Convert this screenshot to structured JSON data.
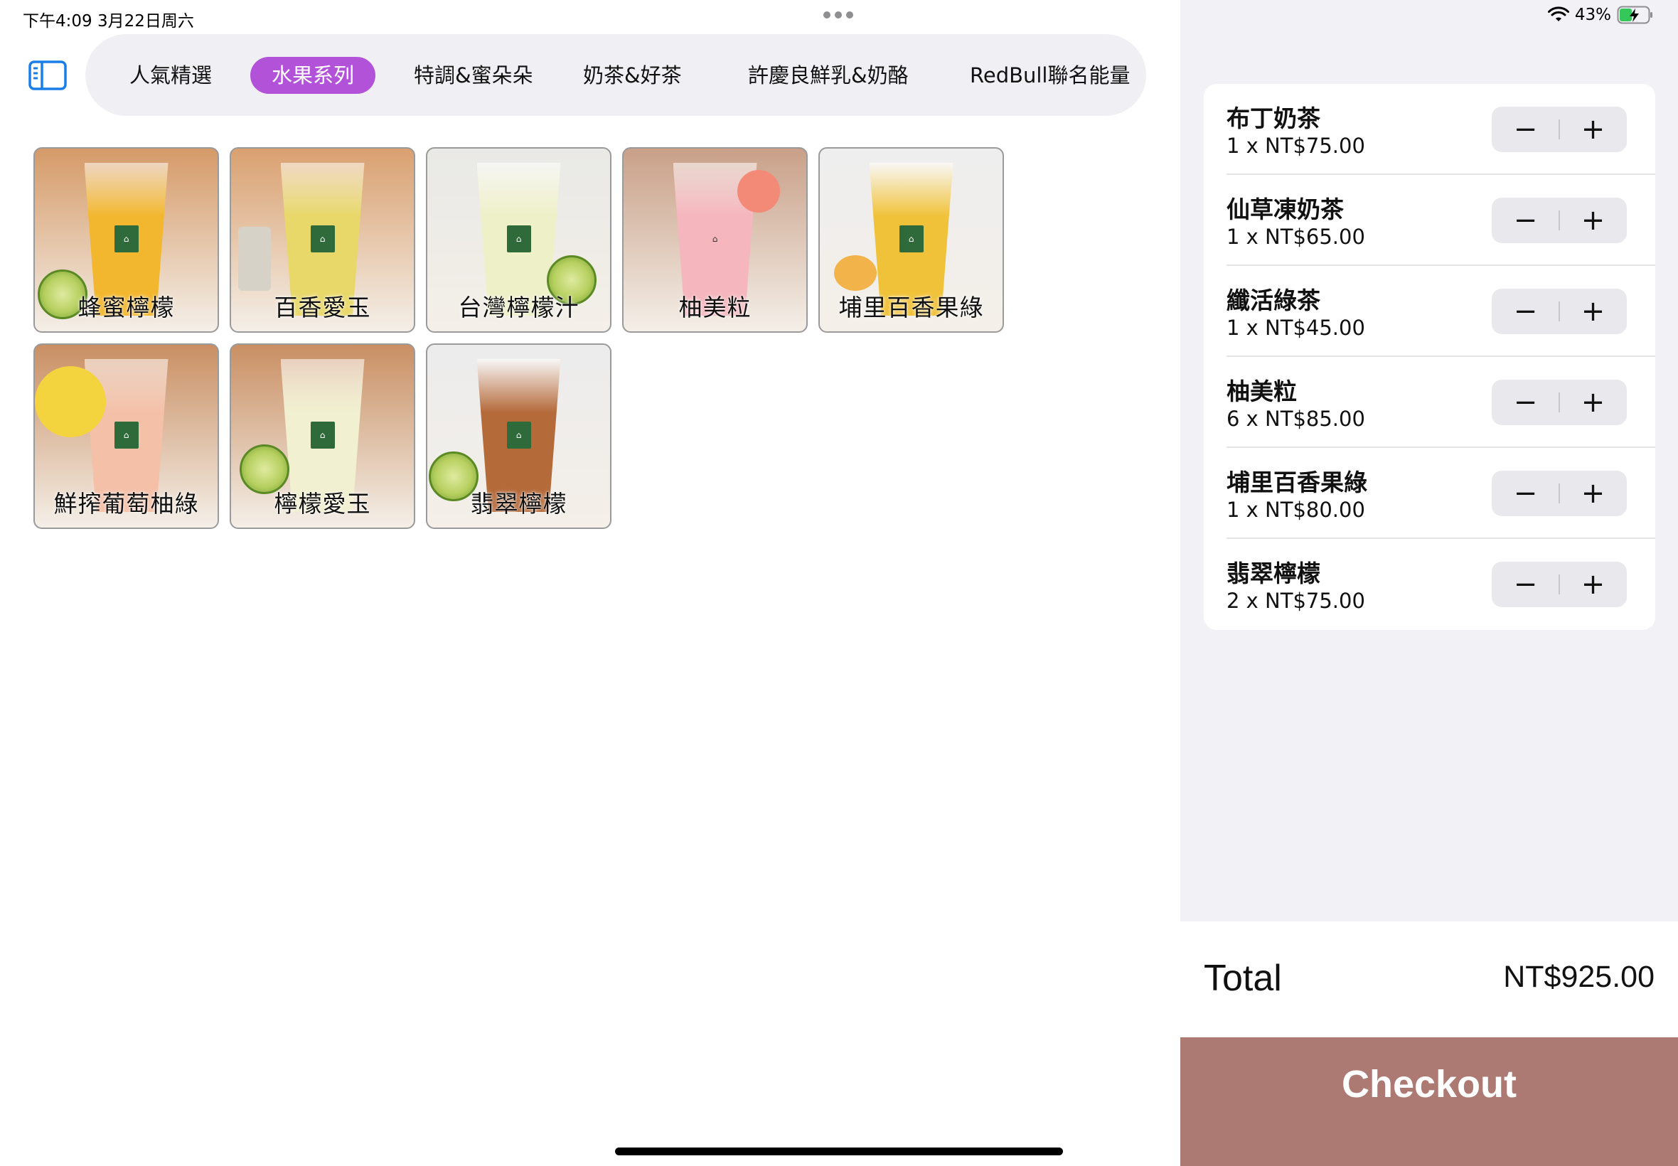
{
  "status_bar": {
    "time": "下午4:09   3月22日周六",
    "battery_percent": "43%",
    "battery_level": 0.43,
    "icons": [
      "wifi-icon",
      "battery-charging-icon"
    ]
  },
  "sidebar_toggle": {
    "icon": "sidebar-icon"
  },
  "categories": [
    {
      "label": "人氣精選",
      "active": false
    },
    {
      "label": "水果系列",
      "active": true
    },
    {
      "label": "特調&蜜朵朵",
      "active": false
    },
    {
      "label": "奶茶&好茶",
      "active": false
    },
    {
      "label": "許慶良鮮乳&奶酪",
      "active": false
    },
    {
      "label": "RedBull聯名能量",
      "active": false
    }
  ],
  "products": [
    {
      "name": "蜂蜜檸檬",
      "drink_color": "#f2b72e",
      "bg_color": "#d59a68"
    },
    {
      "name": "百香愛玉",
      "drink_color": "#e8d86a",
      "bg_color": "#d9a070"
    },
    {
      "name": "台灣檸檬汁",
      "drink_color": "#eef0c8",
      "bg_color": "#e9e9e6"
    },
    {
      "name": "柚美粒",
      "drink_color": "#f5b6bd",
      "bg_color": "#c9a088"
    },
    {
      "name": "埔里百香果綠",
      "drink_color": "#f0c23a",
      "bg_color": "#eeeeee"
    },
    {
      "name": "鮮搾葡萄柚綠",
      "drink_color": "#f5c0a8",
      "bg_color": "#c98f63"
    },
    {
      "name": "檸檬愛玉",
      "drink_color": "#f1f0d0",
      "bg_color": "#c98f63"
    },
    {
      "name": "翡翠檸檬",
      "drink_color": "#b56a3a",
      "bg_color": "#ececec"
    }
  ],
  "cart": {
    "items": [
      {
        "name": "布丁奶茶",
        "qty_text": "1 x NT$75.00"
      },
      {
        "name": "仙草凍奶茶",
        "qty_text": "1 x NT$65.00"
      },
      {
        "name": "纖活綠茶",
        "qty_text": "1 x NT$45.00"
      },
      {
        "name": "柚美粒",
        "qty_text": "6 x NT$85.00"
      },
      {
        "name": "埔里百香果綠",
        "qty_text": "1 x NT$80.00"
      },
      {
        "name": "翡翠檸檬",
        "qty_text": "2 x NT$75.00"
      }
    ],
    "minus_symbol": "−",
    "plus_symbol": "+"
  },
  "total": {
    "label": "Total",
    "value": "NT$925.00"
  },
  "checkout": {
    "label": "Checkout",
    "color": "#ad7a73"
  },
  "colors": {
    "accent": "#b252d8",
    "sidebar_icon": "#1a7de8"
  }
}
